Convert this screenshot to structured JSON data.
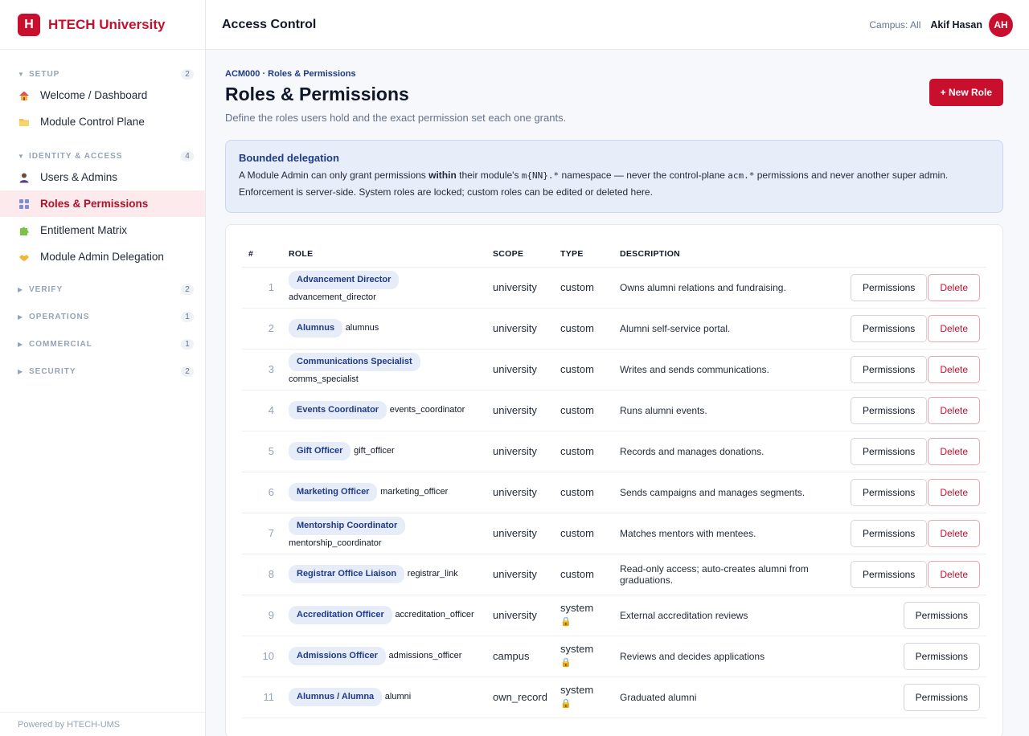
{
  "brand": {
    "logo": "H",
    "name": "HTECH University"
  },
  "nav": {
    "sections": [
      {
        "label": "SETUP",
        "count": "2"
      },
      {
        "label": "IDENTITY & ACCESS",
        "count": "4"
      },
      {
        "label": "VERIFY",
        "count": "2"
      },
      {
        "label": "OPERATIONS",
        "count": "1"
      },
      {
        "label": "COMMERCIAL",
        "count": "1"
      },
      {
        "label": "SECURITY",
        "count": "2"
      }
    ],
    "setup_items": [
      {
        "label": "Welcome / Dashboard",
        "icon": "house-icon"
      },
      {
        "label": "Module Control Plane",
        "icon": "folder-icon"
      }
    ],
    "identity_items": [
      {
        "label": "Users & Admins",
        "icon": "user-icon"
      },
      {
        "label": "Roles & Permissions",
        "icon": "grid-icon"
      },
      {
        "label": "Entitlement Matrix",
        "icon": "puzzle-icon"
      },
      {
        "label": "Module Admin Delegation",
        "icon": "handshake-icon"
      }
    ],
    "footer": "Powered by HTECH-UMS"
  },
  "topbar": {
    "title": "Access Control",
    "campus": "Campus: All",
    "user": "Akif Hasan",
    "avatar": "AH"
  },
  "page": {
    "breadcrumb": "ACM000 · Roles & Permissions",
    "title": "Roles & Permissions",
    "subtitle": "Define the roles users hold and the exact permission set each one grants.",
    "new_role": "+ New Role"
  },
  "info": {
    "title": "Bounded delegation",
    "t1": "A Module Admin can only grant permissions ",
    "t2": "within",
    "t3": " their module's ",
    "t4": "m{NN}.*",
    "t5": " namespace — never the control-plane ",
    "t6": "acm.*",
    "t7": " permissions and never another super admin.",
    "t8": "Enforcement is server-side. System roles are locked; custom roles can be edited or deleted here."
  },
  "table": {
    "headers": {
      "num": "#",
      "role": "ROLE",
      "scope": "SCOPE",
      "type": "TYPE",
      "desc": "DESCRIPTION"
    },
    "permissions_label": "Permissions",
    "delete_label": "Delete",
    "rows": [
      {
        "n": "1",
        "name": "Advancement Director",
        "code": "advancement_director",
        "scope": "university",
        "type": "custom",
        "desc": "Owns alumni relations and fundraising."
      },
      {
        "n": "2",
        "name": "Alumnus",
        "code": "alumnus",
        "scope": "university",
        "type": "custom",
        "desc": "Alumni self-service portal."
      },
      {
        "n": "3",
        "name": "Communications Specialist",
        "code": "comms_specialist",
        "scope": "university",
        "type": "custom",
        "desc": "Writes and sends communications."
      },
      {
        "n": "4",
        "name": "Events Coordinator",
        "code": "events_coordinator",
        "scope": "university",
        "type": "custom",
        "desc": "Runs alumni events."
      },
      {
        "n": "5",
        "name": "Gift Officer",
        "code": "gift_officer",
        "scope": "university",
        "type": "custom",
        "desc": "Records and manages donations."
      },
      {
        "n": "6",
        "name": "Marketing Officer",
        "code": "marketing_officer",
        "scope": "university",
        "type": "custom",
        "desc": "Sends campaigns and manages segments."
      },
      {
        "n": "7",
        "name": "Mentorship Coordinator",
        "code": "mentorship_coordinator",
        "scope": "university",
        "type": "custom",
        "desc": "Matches mentors with mentees."
      },
      {
        "n": "8",
        "name": "Registrar Office Liaison",
        "code": "registrar_link",
        "scope": "university",
        "type": "custom",
        "desc": "Read-only access; auto-creates alumni from graduations."
      },
      {
        "n": "9",
        "name": "Accreditation Officer",
        "code": "accreditation_officer",
        "scope": "university",
        "type": "system",
        "desc": "External accreditation reviews"
      },
      {
        "n": "10",
        "name": "Admissions Officer",
        "code": "admissions_officer",
        "scope": "campus",
        "type": "system",
        "desc": "Reviews and decides applications"
      },
      {
        "n": "11",
        "name": "Alumnus / Alumna",
        "code": "alumni",
        "scope": "own_record",
        "type": "system",
        "desc": "Graduated alumni"
      }
    ]
  }
}
